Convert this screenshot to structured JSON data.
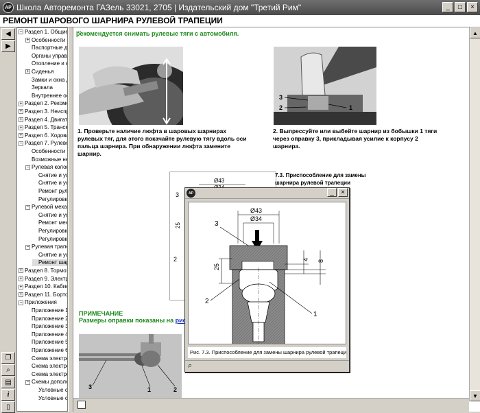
{
  "window": {
    "title": "Школа Авторемонта ГАЗель 33021, 2705 | Издательский дом \"Третий Рим\"",
    "logo": "АР",
    "buttons": {
      "minimize": "_",
      "maximize": "□",
      "close": "×"
    }
  },
  "page_title": "РЕМОНТ ШАРОВОГО ШАРНИРА РУЛЕВОЙ ТРАПЕЦИИ",
  "toolbar_top": [
    {
      "name": "back-arrow-icon",
      "glyph": "◀"
    },
    {
      "name": "forward-arrow-icon",
      "glyph": "▶"
    }
  ],
  "toolbar_bottom": [
    {
      "name": "copy-icon",
      "glyph": "❐"
    },
    {
      "name": "zoom-icon",
      "glyph": "⌕"
    },
    {
      "name": "print-icon",
      "glyph": "▤"
    },
    {
      "name": "info-icon",
      "glyph": "i"
    },
    {
      "name": "page-icon",
      "glyph": "▯"
    }
  ],
  "tree": [
    {
      "label": "Раздел 1. Общие с",
      "level": 1,
      "box": "−"
    },
    {
      "label": "Особенности к",
      "level": 2,
      "box": "+"
    },
    {
      "label": "Паспортные да",
      "level": 2,
      "box": ""
    },
    {
      "label": "Органы управл",
      "level": 2,
      "box": ""
    },
    {
      "label": "Отопление и ве",
      "level": 2,
      "box": ""
    },
    {
      "label": "Сиденья",
      "level": 2,
      "box": "+"
    },
    {
      "label": "Замки и окна д",
      "level": 2,
      "box": ""
    },
    {
      "label": "Зеркала",
      "level": 2,
      "box": ""
    },
    {
      "label": "Внутреннее осв",
      "level": 2,
      "box": ""
    },
    {
      "label": "Раздел 2. Рекоме",
      "level": 1,
      "box": "+"
    },
    {
      "label": "Раздел 3. Неиспра",
      "level": 1,
      "box": "+"
    },
    {
      "label": "Раздел 4. Двигате",
      "level": 1,
      "box": "+"
    },
    {
      "label": "Раздел 5. Трансми",
      "level": 1,
      "box": "+"
    },
    {
      "label": "Раздел 6. Ходовая",
      "level": 1,
      "box": "+"
    },
    {
      "label": "Раздел 7. Рулевое",
      "level": 1,
      "box": "−"
    },
    {
      "label": "Особенности к",
      "level": 2,
      "box": ""
    },
    {
      "label": "Возможные не",
      "level": 2,
      "box": ""
    },
    {
      "label": "Рулевая колон",
      "level": 2,
      "box": "−"
    },
    {
      "label": "Снятие и ус",
      "level": 3,
      "box": ""
    },
    {
      "label": "Снятие и ус",
      "level": 3,
      "box": ""
    },
    {
      "label": "Ремонт рул",
      "level": 3,
      "box": ""
    },
    {
      "label": "Регулировк",
      "level": 3,
      "box": ""
    },
    {
      "label": "Рулевой механ",
      "level": 2,
      "box": "−"
    },
    {
      "label": "Снятие и ус",
      "level": 3,
      "box": ""
    },
    {
      "label": "Ремонт мех",
      "level": 3,
      "box": ""
    },
    {
      "label": "Регулировк",
      "level": 3,
      "box": ""
    },
    {
      "label": "Регулировк",
      "level": 3,
      "box": ""
    },
    {
      "label": "Рулевая трапе",
      "level": 2,
      "box": "−"
    },
    {
      "label": "Снятие и ус",
      "level": 3,
      "box": ""
    },
    {
      "label": "Ремонт шар",
      "level": 3,
      "box": "",
      "selected": true
    },
    {
      "label": "Раздел 8. Тормозн",
      "level": 1,
      "box": "+"
    },
    {
      "label": "Раздел 9. Электро",
      "level": 1,
      "box": "+"
    },
    {
      "label": "Раздел 10. Кабина",
      "level": 1,
      "box": "+"
    },
    {
      "label": "Раздел 11. Бортова",
      "level": 1,
      "box": "+"
    },
    {
      "label": "Приложения",
      "level": 1,
      "box": "−"
    },
    {
      "label": "Приложение 1.",
      "level": 2,
      "box": ""
    },
    {
      "label": "Приложение 2.",
      "level": 2,
      "box": ""
    },
    {
      "label": "Приложение 3.",
      "level": 2,
      "box": ""
    },
    {
      "label": "Приложение 4.",
      "level": 2,
      "box": ""
    },
    {
      "label": "Приложение 5.",
      "level": 2,
      "box": ""
    },
    {
      "label": "Приложение 6.",
      "level": 2,
      "box": ""
    },
    {
      "label": "Схема электро",
      "level": 2,
      "box": ""
    },
    {
      "label": "Схема электро",
      "level": 2,
      "box": ""
    },
    {
      "label": "Схема электро",
      "level": 2,
      "box": ""
    },
    {
      "label": "Схемы дополни",
      "level": 2,
      "box": "−"
    },
    {
      "label": "Условные с",
      "level": 3,
      "box": ""
    },
    {
      "label": "Условные с",
      "level": 3,
      "box": ""
    }
  ],
  "content": {
    "intro_line1": "...",
    "intro_line2": "рекомендуется снимать рулевые тяги с автомобиля.",
    "step1": "1. Проверьте наличие люфта в шаровых шарнирах рулевых тяг, для этого покачайте рулевую тягу вдоль оси пальца шарнира. При обнаружении люфта замените шарнир.",
    "step2": "2. Выпрессуйте или выбейте шарнир из бобышки 1 тяги через оправку 3, прикладывая усилие к корпусу 2 шарнира.",
    "fig_caption": "7.3. Приспособление для замены шарнира рулевой трапеции",
    "note_title": "ПРИМЕЧАНИЕ",
    "note_text": "Размеры оправки показаны на",
    "note_link": "рис. 7.3",
    "callouts_photo2": [
      "3",
      "2",
      "1"
    ],
    "callouts_photo3": [
      "3",
      "1",
      "2"
    ]
  },
  "drawing": {
    "d43": "Ø43",
    "d34": "Ø34",
    "dim25": "25",
    "dim4": "4",
    "dim8": "8",
    "label1": "1",
    "label2": "2",
    "label3": "3"
  },
  "popup": {
    "logo": "АР",
    "caption": "Рис. 7.3. Приспособление для замены шарнира рулевой трапеции",
    "zoom_glyph": "⌕",
    "minimize": "_",
    "close": "×"
  },
  "colors": {
    "green": "#1d8a1d",
    "link": "#1a2fbf",
    "hatch": "#7a7a7a"
  }
}
